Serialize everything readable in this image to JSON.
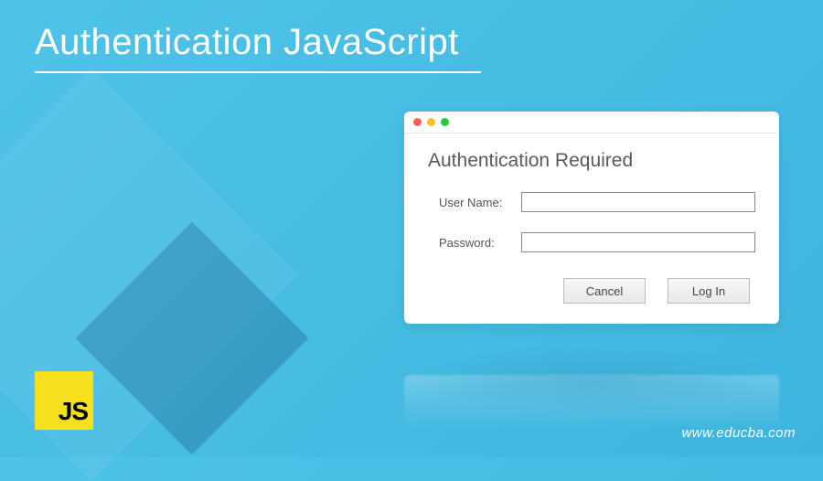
{
  "page": {
    "title": "Authentication JavaScript"
  },
  "dialog": {
    "heading": "Authentication Required",
    "username_label": "User Name:",
    "username_value": "",
    "password_label": "Password:",
    "password_value": "",
    "cancel_label": "Cancel",
    "login_label": "Log In"
  },
  "logo": {
    "text": "JS"
  },
  "footer": {
    "url": "www.educba.com"
  }
}
